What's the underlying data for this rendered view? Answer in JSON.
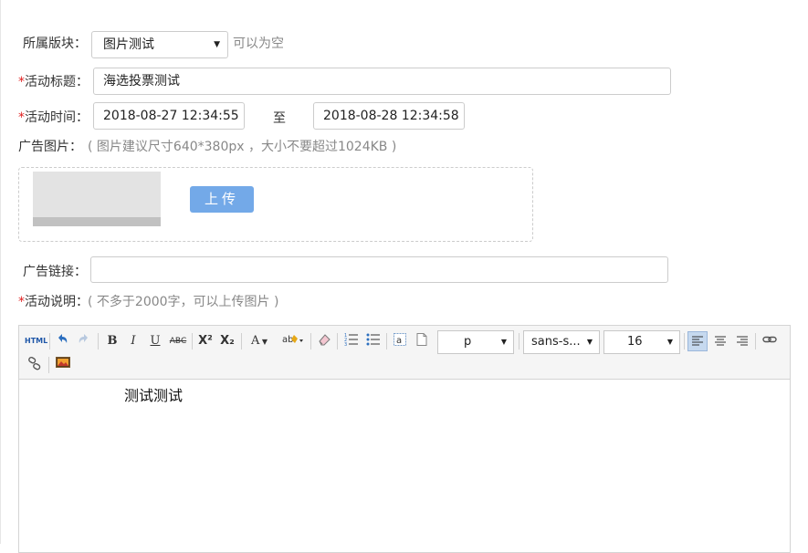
{
  "form": {
    "block": {
      "label": "所属版块：",
      "value": "图片测试",
      "hint": "可以为空"
    },
    "title": {
      "required_mark": "*",
      "label": "活动标题：",
      "value": "海选投票测试"
    },
    "time": {
      "required_mark": "*",
      "label": "活动时间：",
      "start": "2018-08-27 12:34:55",
      "separator": "至",
      "end": "2018-08-28 12:34:58"
    },
    "ad_image": {
      "label": "广告图片：",
      "hint": "( 图片建议尺寸640*380px ，大小不要超过1024KB )",
      "upload_label": "上传"
    },
    "ad_link": {
      "label": "广告链接：",
      "value": ""
    },
    "description": {
      "required_mark": "*",
      "label": "活动说明：",
      "hint": "( 不多于2000字，可以上传图片 )"
    }
  },
  "editor": {
    "toolbar": {
      "html": "HTML",
      "bold": "B",
      "italic": "I",
      "underline": "U",
      "strike": "ABC",
      "superscript": "X²",
      "subscript": "X₂",
      "font_color": "A",
      "paragraph": "p",
      "font_family": "sans-s...",
      "font_size": "16"
    },
    "content": "测试测试"
  },
  "colors": {
    "required": "#e02020",
    "upload_button": "#73a9e8",
    "hint": "#888888"
  }
}
